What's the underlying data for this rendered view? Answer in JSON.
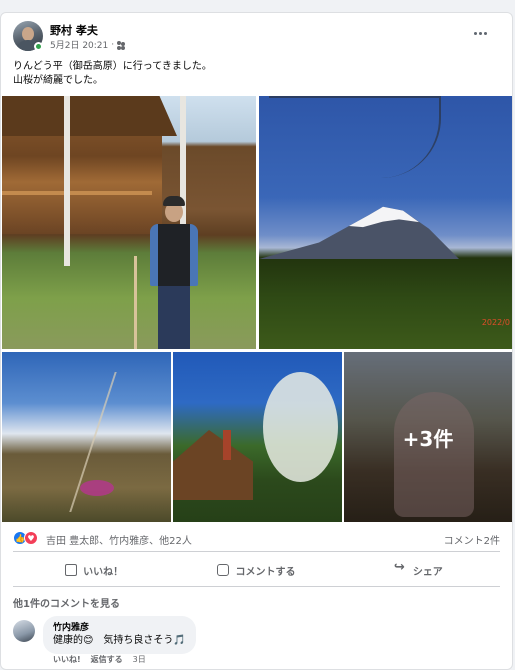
{
  "post": {
    "author": "野村 孝夫",
    "date": "5月2日 20:21",
    "audience_icon": "friends-icon",
    "text_line1": "りんどう平（御岳高原）に行ってきました。",
    "text_line2": "山桜が綺麗でした。"
  },
  "photos": {
    "date_stamp": "2022/0",
    "more_count": "+3件"
  },
  "reactions": {
    "names": "吉田 豊太郎、竹内雅彦、他22人",
    "comment_count": "コメント2件"
  },
  "actions": {
    "like": "いいね！",
    "comment": "コメントする",
    "share": "シェア"
  },
  "comments": {
    "view_more": "他1件のコメントを見る",
    "author": "竹内雅彦",
    "text": "健康的😊　気持ち良さそう🎵",
    "like": "いいね!",
    "reply": "返信する",
    "time": "3日"
  },
  "colors": {
    "accent": "#1877f2",
    "love": "#f33e58",
    "online": "#31a24c",
    "muted_text": "#65676b"
  }
}
